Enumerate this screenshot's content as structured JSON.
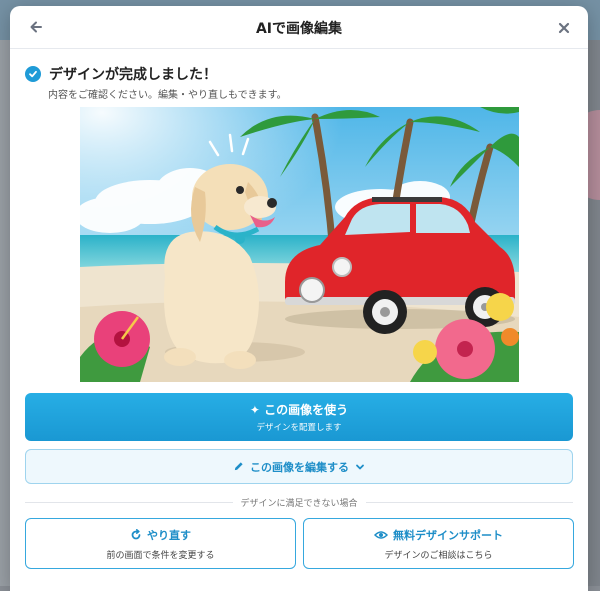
{
  "modal": {
    "title": "AIで画像編集",
    "back_icon": "arrow-left-icon",
    "close_icon": "close-icon"
  },
  "status": {
    "title": "デザインが完成しました！",
    "subtitle": "内容をご確認ください。編集・やり直しもできます。"
  },
  "preview": {
    "icon": "generated-image"
  },
  "actions": {
    "use_image": {
      "label": "✦ この画像を使う",
      "sublabel": "デザインを配置します"
    },
    "edit_image": {
      "label": "この画像を編集する"
    },
    "divider_text": "デザインに満足できない場合",
    "retry": {
      "label": "やり直す",
      "sublabel": "前の画面で条件を変更する"
    },
    "support": {
      "label": "無料デザインサポート",
      "sublabel": "デザインのご相談はこちら"
    }
  },
  "colors": {
    "accent": "#1f9bd7",
    "accent_light": "#eef8fd"
  }
}
